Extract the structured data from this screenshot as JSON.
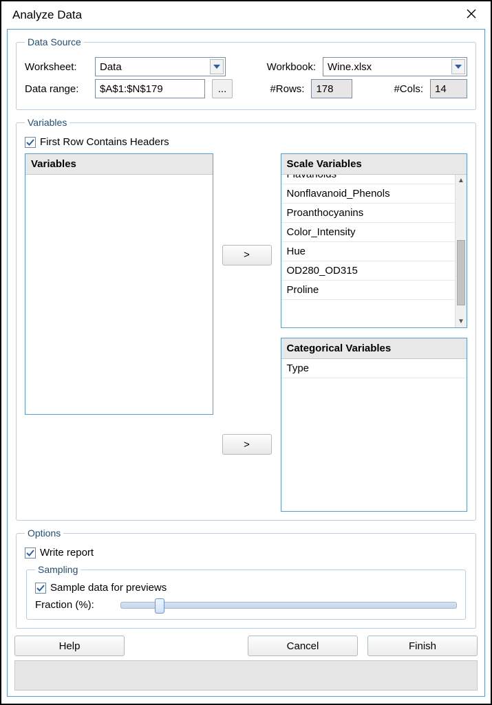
{
  "title": "Analyze Data",
  "dataSource": {
    "legend": "Data Source",
    "worksheetLabel": "Worksheet:",
    "worksheetValue": "Data",
    "workbookLabel": "Workbook:",
    "workbookValue": "Wine.xlsx",
    "dataRangeLabel": "Data range:",
    "dataRangeValue": "$A$1:$N$179",
    "browseLabel": "...",
    "rowsLabel": "#Rows:",
    "rowsValue": "178",
    "colsLabel": "#Cols:",
    "colsValue": "14"
  },
  "variables": {
    "legend": "Variables",
    "firstRowHeadersLabel": "First Row Contains Headers",
    "firstRowHeadersChecked": true,
    "sourceHeader": "Variables",
    "scaleHeader": "Scale Variables",
    "scaleItems": [
      "Flavanoids",
      "Nonflavanoid_Phenols",
      "Proanthocyanins",
      "Color_Intensity",
      "Hue",
      "OD280_OD315",
      "Proline"
    ],
    "categoricalHeader": "Categorical Variables",
    "categoricalItems": [
      "Type"
    ],
    "moveLabel": ">"
  },
  "options": {
    "legend": "Options",
    "writeReportLabel": "Write report",
    "writeReportChecked": true,
    "sampling": {
      "legend": "Sampling",
      "sampleLabel": "Sample data for previews",
      "sampleChecked": true,
      "fractionLabel": "Fraction (%):",
      "fractionPercent": 10
    }
  },
  "buttons": {
    "help": "Help",
    "cancel": "Cancel",
    "finish": "Finish"
  }
}
